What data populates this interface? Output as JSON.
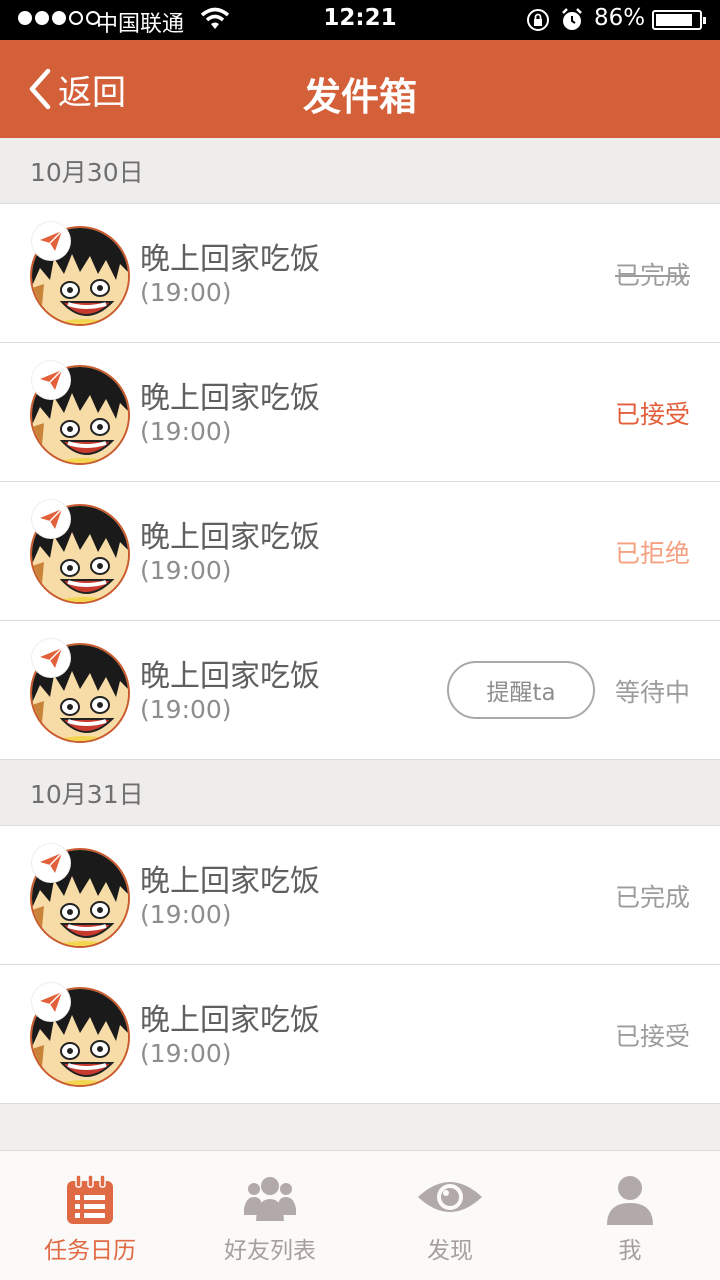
{
  "status_bar": {
    "carrier": "中国联通",
    "time": "12:21",
    "battery": "86%",
    "battery_level": 0.86
  },
  "nav": {
    "back_label": "返回",
    "title": "发件箱"
  },
  "sections": [
    {
      "date": "10月30日",
      "rows": [
        {
          "task": "晚上回家吃饭",
          "time": "(19:00)",
          "status": "已完成",
          "style": "done-strike"
        },
        {
          "task": "晚上回家吃饭",
          "time": "(19:00)",
          "status": "已接受",
          "style": "accepted"
        },
        {
          "task": "晚上回家吃饭",
          "time": "(19:00)",
          "status": "已拒绝",
          "style": "rejected"
        },
        {
          "task": "晚上回家吃饭",
          "time": "(19:00)",
          "status": "等待中",
          "style": "waiting",
          "action": "提醒ta"
        }
      ]
    },
    {
      "date": "10月31日",
      "rows": [
        {
          "task": "晚上回家吃饭",
          "time": "(19:00)",
          "status": "已完成",
          "style": "done"
        },
        {
          "task": "晚上回家吃饭",
          "time": "(19:00)",
          "status": "已接受",
          "style": "accepted-grey"
        }
      ]
    }
  ],
  "tabs": [
    {
      "label": "任务日历",
      "icon": "calendar-list-icon",
      "active": true
    },
    {
      "label": "好友列表",
      "icon": "friends-group-icon",
      "active": false
    },
    {
      "label": "发现",
      "icon": "eye-icon",
      "active": false
    },
    {
      "label": "我",
      "icon": "person-icon",
      "active": false
    }
  ],
  "colors": {
    "accent": "#d4603a",
    "accepted": "#e35f3b",
    "rejected": "#f5a080",
    "muted": "#9c9c9c"
  }
}
